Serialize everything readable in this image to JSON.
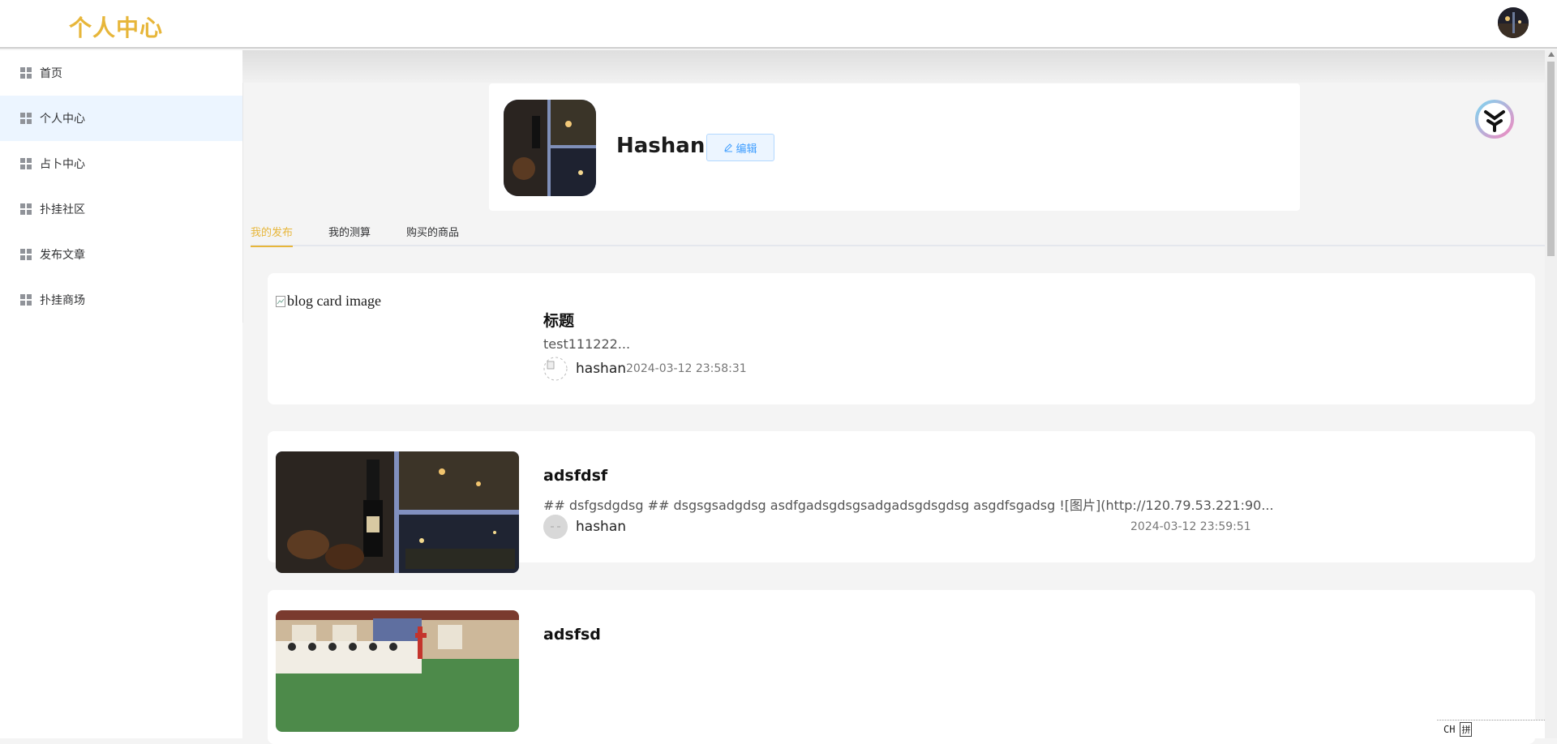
{
  "header": {
    "brand_title": "个人中心",
    "avatar_icon": "user-avatar"
  },
  "sidebar": {
    "items": [
      {
        "label": "首页",
        "icon": "grid-icon",
        "active": false
      },
      {
        "label": "个人中心",
        "icon": "grid-icon",
        "active": true
      },
      {
        "label": "占卜中心",
        "icon": "grid-icon",
        "active": false
      },
      {
        "label": "扑挂社区",
        "icon": "grid-icon",
        "active": false
      },
      {
        "label": "发布文章",
        "icon": "grid-icon",
        "active": false
      },
      {
        "label": "扑挂商场",
        "icon": "grid-icon",
        "active": false
      }
    ]
  },
  "profile": {
    "name": "Hashan",
    "edit_label": "编辑"
  },
  "tabs": [
    {
      "label": "我的发布",
      "active": true
    },
    {
      "label": "我的测算",
      "active": false
    },
    {
      "label": "购买的商品",
      "active": false
    }
  ],
  "posts": [
    {
      "image_alt": "blog card image",
      "title": "标题",
      "excerpt": "test111222...",
      "author": "hashan",
      "time": "2024-03-12 23:58:31"
    },
    {
      "title": "adsfdsf",
      "excerpt": "## dsfgsdgdsg ## dsgsgsadgdsg asdfgadsgdsgsadgadsgdsgdsg asgdfsgadsg ![图片](http://120.79.53.221:90...",
      "author": "hashan",
      "time": "2024-03-12 23:59:51"
    },
    {
      "title": "adsfsd"
    }
  ],
  "ime": {
    "mode": "CH",
    "layout": "拼"
  },
  "colors": {
    "accent": "#e7b63a",
    "active_menu_bg": "#ecf5ff",
    "edit_button_text": "#409eff"
  }
}
